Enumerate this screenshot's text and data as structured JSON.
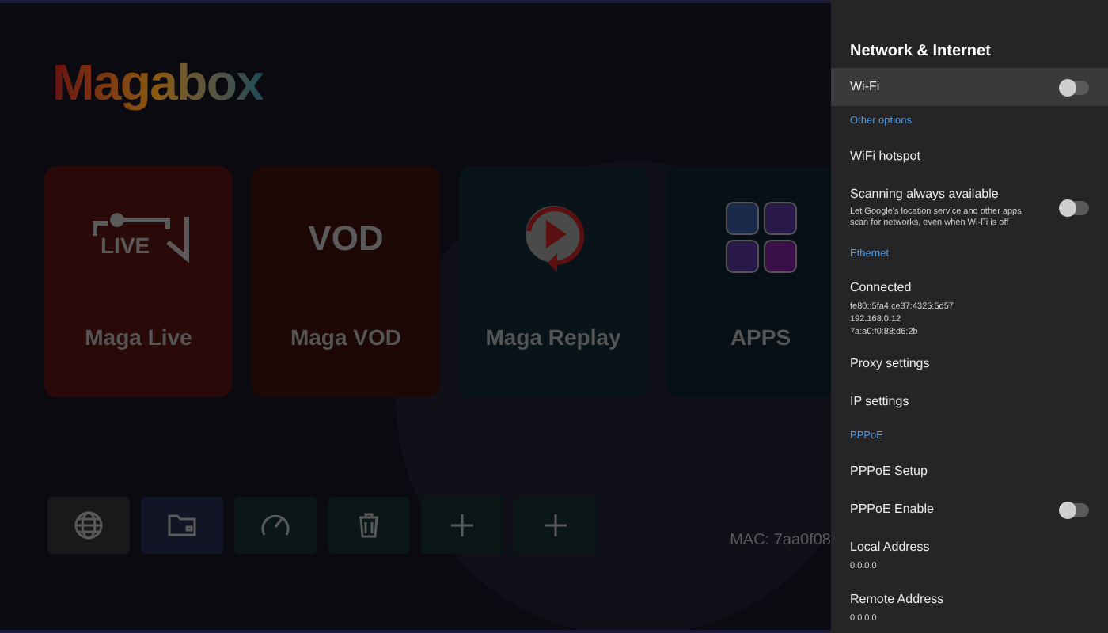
{
  "logo": {
    "text": "Magabox"
  },
  "tiles": [
    {
      "kind": "live",
      "icon_text": "LIVE",
      "label": "Maga Live"
    },
    {
      "kind": "vod",
      "icon_text": "VOD",
      "label": "Maga VOD"
    },
    {
      "kind": "replay",
      "label": "Maga Replay"
    },
    {
      "kind": "apps",
      "label": "APPS"
    }
  ],
  "shortcuts": [
    {
      "kind": "globe"
    },
    {
      "kind": "folder"
    },
    {
      "kind": "gauge"
    },
    {
      "kind": "trash"
    },
    {
      "kind": "plus"
    },
    {
      "kind": "plus"
    }
  ],
  "mac": "MAC: 7aa0f08",
  "panel": {
    "title": "Network & Internet",
    "items": [
      {
        "kind": "toggle",
        "label": "Wi-Fi",
        "on": false,
        "selected": true
      },
      {
        "kind": "header",
        "label": "Other options"
      },
      {
        "kind": "item",
        "label": "WiFi hotspot",
        "selected": false
      },
      {
        "kind": "toggle",
        "label": "Scanning always available",
        "description": "Let Google's location service and other apps scan for networks, even when Wi-Fi is off",
        "on": false,
        "selected": false
      },
      {
        "kind": "header",
        "label": "Ethernet"
      },
      {
        "kind": "item",
        "label": "Connected",
        "details": [
          "fe80::5fa4:ce37:4325:5d57",
          "192.168.0.12",
          "7a:a0:f0:88:d6:2b"
        ],
        "selected": false
      },
      {
        "kind": "item",
        "label": "Proxy settings",
        "selected": false
      },
      {
        "kind": "item",
        "label": "IP settings",
        "selected": false
      },
      {
        "kind": "header",
        "label": "PPPoE"
      },
      {
        "kind": "item",
        "label": "PPPoE Setup",
        "selected": false
      },
      {
        "kind": "toggle",
        "label": "PPPoE Enable",
        "on": false,
        "selected": false
      },
      {
        "kind": "item",
        "label": "Local Address",
        "details": [
          "0.0.0.0"
        ],
        "selected": false
      },
      {
        "kind": "item",
        "label": "Remote Address",
        "details": [
          "0.0.0.0"
        ],
        "selected": false
      }
    ]
  }
}
